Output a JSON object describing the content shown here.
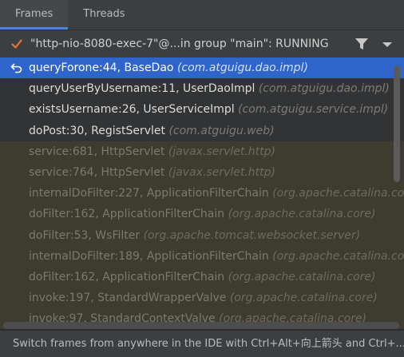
{
  "tabs": [
    {
      "label": "Frames",
      "active": true
    },
    {
      "label": "Threads",
      "active": false
    }
  ],
  "thread": {
    "label": "\"http-nio-8080-exec-7\"@...in group \"main\": RUNNING",
    "status_icon": "check-icon",
    "filter_icon": "filter-icon",
    "dropdown_icon": "chevron-down-icon"
  },
  "frames": [
    {
      "method": "queryForone:44, BaseDao",
      "package": "(com.atguigu.dao.impl)",
      "kind": "selected"
    },
    {
      "method": "queryUserByUsername:11, UserDaoImpl",
      "package": "(com.atguigu.dao.impl)",
      "kind": "app"
    },
    {
      "method": "existsUsername:26, UserServiceImpl",
      "package": "(com.atguigu.service.impl)",
      "kind": "app"
    },
    {
      "method": "doPost:30, RegistServlet",
      "package": "(com.atguigu.web)",
      "kind": "app"
    },
    {
      "method": "service:681, HttpServlet",
      "package": "(javax.servlet.http)",
      "kind": "lib"
    },
    {
      "method": "service:764, HttpServlet",
      "package": "(javax.servlet.http)",
      "kind": "lib"
    },
    {
      "method": "internalDoFilter:227, ApplicationFilterChain",
      "package": "(org.apache.catalina.core)",
      "kind": "lib"
    },
    {
      "method": "doFilter:162, ApplicationFilterChain",
      "package": "(org.apache.catalina.core)",
      "kind": "lib"
    },
    {
      "method": "doFilter:53, WsFilter",
      "package": "(org.apache.tomcat.websocket.server)",
      "kind": "lib"
    },
    {
      "method": "internalDoFilter:189, ApplicationFilterChain",
      "package": "(org.apache.catalina.core)",
      "kind": "lib"
    },
    {
      "method": "doFilter:162, ApplicationFilterChain",
      "package": "(org.apache.catalina.core)",
      "kind": "lib"
    },
    {
      "method": "invoke:197, StandardWrapperValve",
      "package": "(org.apache.catalina.core)",
      "kind": "lib"
    },
    {
      "method": "invoke:97, StandardContextValve",
      "package": "(org.apache.catalina.core)",
      "kind": "lib"
    }
  ],
  "hint": "Switch frames from anywhere in the IDE with Ctrl+Alt+向上箭头 and Ctrl+...",
  "colors": {
    "selection": "#2f65ca",
    "tab_underline": "#4a88c7",
    "check": "#e0773a",
    "library_row": "#3e3b2f"
  }
}
